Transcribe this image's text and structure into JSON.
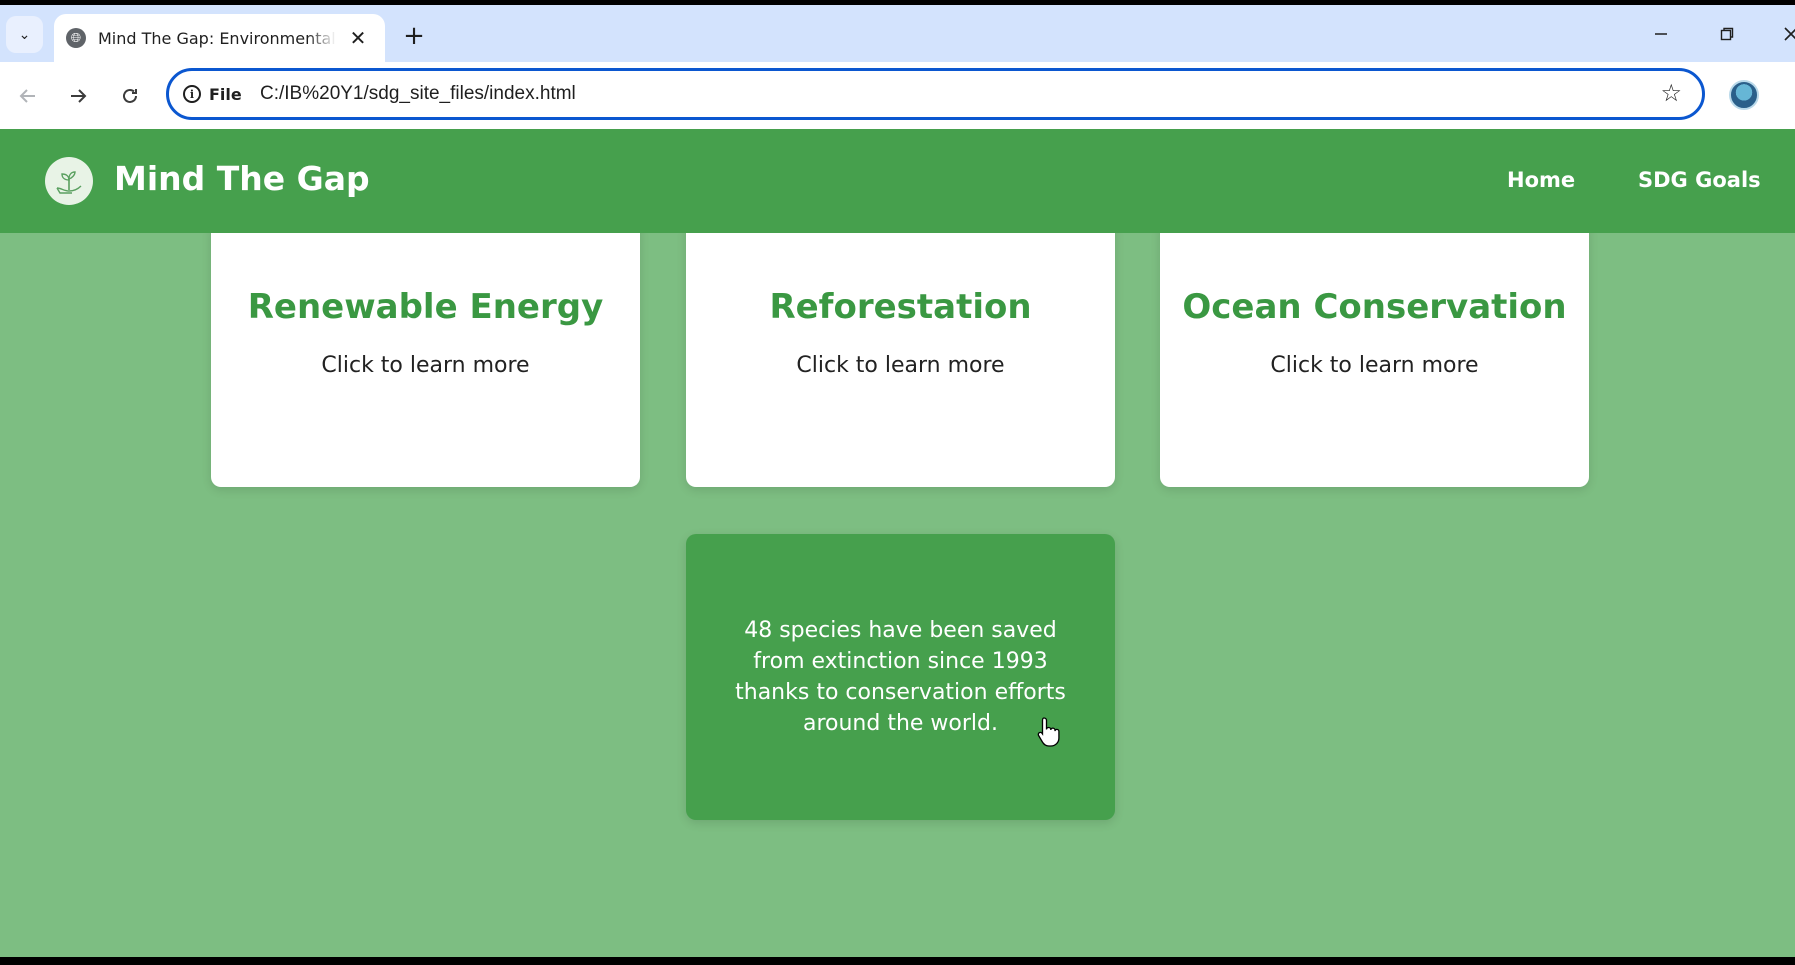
{
  "browser": {
    "tab_title": "Mind The Gap: Environmental P",
    "new_tab_symbol": "+",
    "close_symbol": "✕",
    "site_chip": "File",
    "url": "C:/IB%20Y1/sdg_site_files/index.html",
    "accent_color": "#0b57d0"
  },
  "site": {
    "brand": "Mind The Gap",
    "nav": {
      "home": "Home",
      "sdg_goals": "SDG Goals"
    },
    "header_color": "#46a04d",
    "background_color": "#7dbe82"
  },
  "cards": [
    {
      "title": "Renewable Energy",
      "subtitle": "Click to learn more"
    },
    {
      "title": "Reforestation",
      "subtitle": "Click to learn more"
    },
    {
      "title": "Ocean Conservation",
      "subtitle": "Click to learn more"
    }
  ],
  "fact_card": {
    "text": "48 species have been saved from extinction since 1993 thanks to conservation efforts around the world."
  }
}
